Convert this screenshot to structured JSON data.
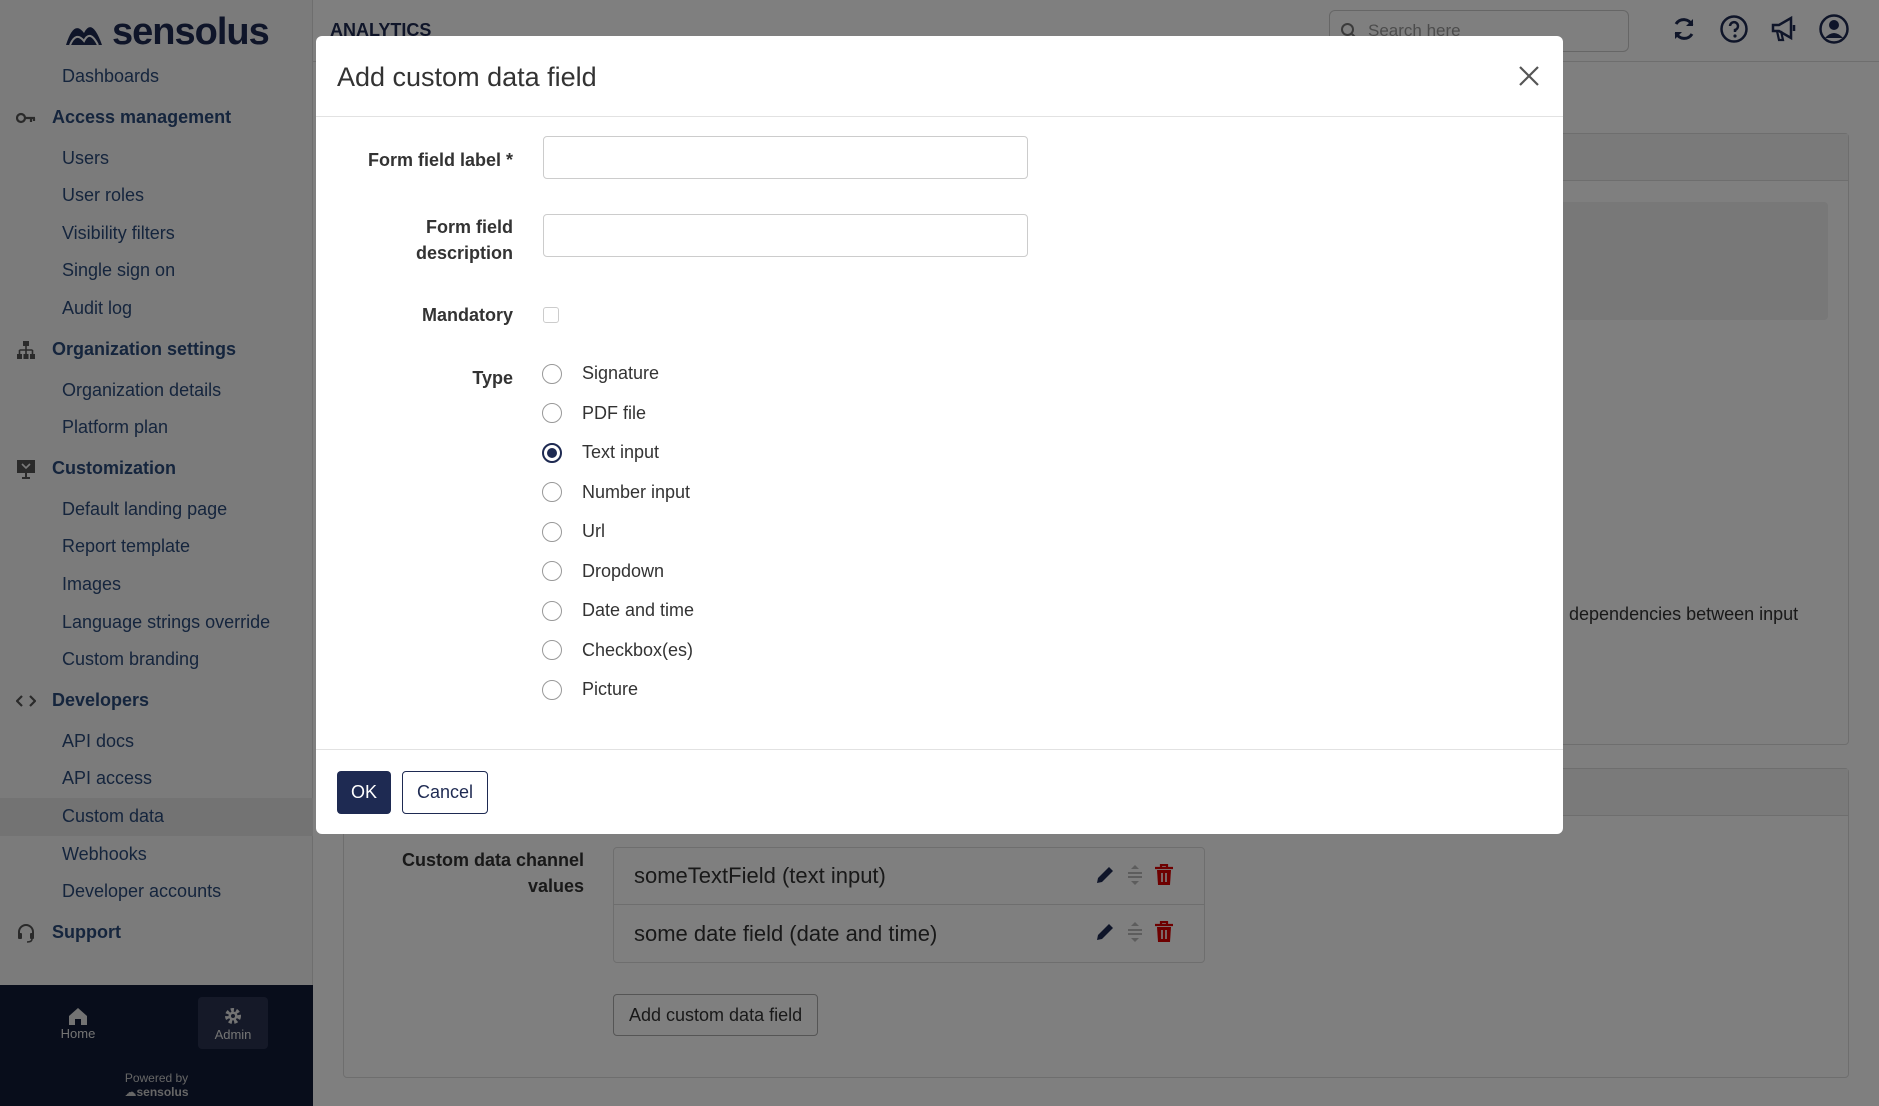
{
  "app": {
    "logo_text": "sensolus",
    "section_title": "ANALYTICS",
    "search_placeholder": "Search here"
  },
  "sidebar": {
    "dashboards": "Dashboards",
    "access_management": {
      "title": "Access management",
      "items": [
        "Users",
        "User roles",
        "Visibility filters",
        "Single sign on",
        "Audit log"
      ]
    },
    "organization_settings": {
      "title": "Organization settings",
      "items": [
        "Organization details",
        "Platform plan"
      ]
    },
    "customization": {
      "title": "Customization",
      "items": [
        "Default landing page",
        "Report template",
        "Images",
        "Language strings override",
        "Custom branding"
      ]
    },
    "developers": {
      "title": "Developers",
      "items": [
        "API docs",
        "API access",
        "Custom data",
        "Webhooks",
        "Developer accounts"
      ]
    },
    "support": {
      "title": "Support"
    },
    "bottom": {
      "home": "Home",
      "admin": "Admin",
      "powered_by": "Powered by",
      "powered_logo": "sensolus"
    }
  },
  "background": {
    "partial_text": "dependencies between input",
    "custom_data_label": "Custom data channel values",
    "custom_data_items": [
      "someTextField (text input)",
      "some date field (date and time)"
    ],
    "add_button": "Add custom data field"
  },
  "modal": {
    "title": "Add custom data field",
    "label_field": {
      "label": "Form field label *",
      "value": ""
    },
    "description_field": {
      "label": "Form field description",
      "value": ""
    },
    "mandatory": {
      "label": "Mandatory",
      "checked": false
    },
    "type": {
      "label": "Type",
      "options": [
        "Signature",
        "PDF file",
        "Text input",
        "Number input",
        "Url",
        "Dropdown",
        "Date and time",
        "Checkbox(es)",
        "Picture"
      ],
      "selected": "Text input"
    },
    "ok": "OK",
    "cancel": "Cancel"
  }
}
